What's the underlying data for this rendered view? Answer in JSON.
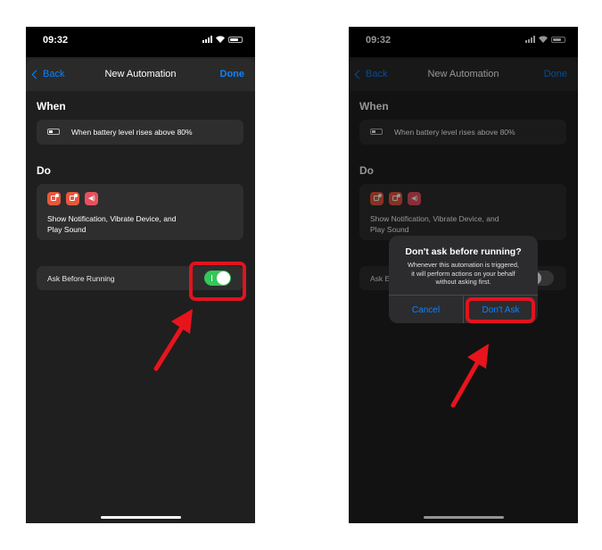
{
  "colors": {
    "accent": "#0a84ff",
    "toggle_on": "#34c759",
    "highlight": "#e0141e",
    "arrow": "#e8141c"
  },
  "left": {
    "status": {
      "time": "09:32"
    },
    "nav": {
      "back_label": "Back",
      "title": "New Automation",
      "done_label": "Done"
    },
    "when": {
      "heading": "When",
      "trigger_text": "When battery level rises above 80%",
      "icon": "battery-icon"
    },
    "do": {
      "heading": "Do",
      "action_icons": [
        "notification-icon",
        "vibrate-icon",
        "sound-icon"
      ],
      "summary_line1": "Show Notification, Vibrate Device, and",
      "summary_line2": "Play Sound"
    },
    "ask": {
      "label": "Ask Before Running",
      "toggle_on": true
    }
  },
  "right": {
    "status": {
      "time": "09:32"
    },
    "nav": {
      "back_label": "Back",
      "title": "New Automation",
      "done_label": "Done"
    },
    "when": {
      "heading": "When",
      "trigger_text": "When battery level rises above 80%"
    },
    "do": {
      "heading": "Do",
      "summary_line1": "Show Notification, Vibrate Device, and",
      "summary_line2": "Play Sound"
    },
    "ask": {
      "label_partial": "Ask E",
      "toggle_on": false
    },
    "alert": {
      "title": "Don't ask before running?",
      "message_line1": "Whenever this automation is triggered,",
      "message_line2": "it will perform actions on your behalf",
      "message_line3": "without asking first.",
      "cancel_label": "Cancel",
      "confirm_label": "Don't Ask"
    }
  }
}
